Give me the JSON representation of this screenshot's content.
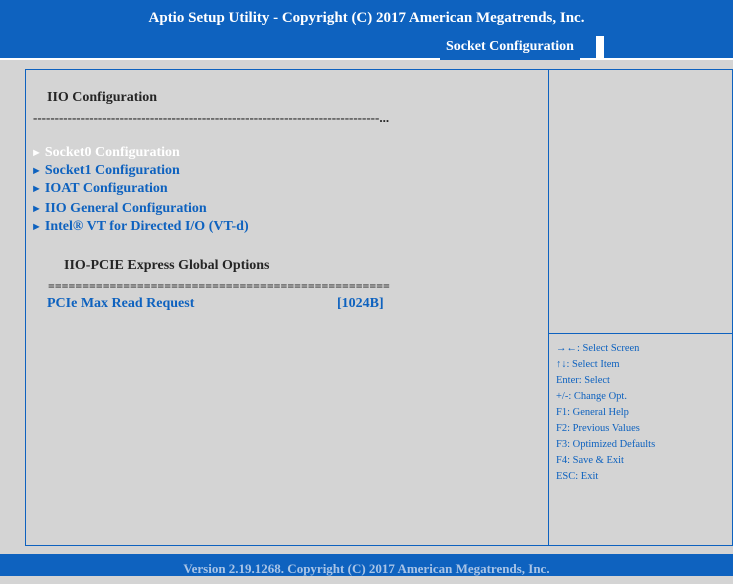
{
  "header": {
    "title": "Aptio Setup Utility - Copyright (C) 2017 American Megatrends, Inc."
  },
  "tabs": [
    {
      "label": "Socket Configuration"
    }
  ],
  "main": {
    "section_title": "IIO Configuration",
    "dashes": "--------------------------------------------------------------------------------...",
    "menu_arrow": "►",
    "menu_items": [
      {
        "label": "Socket0 Configuration"
      },
      {
        "label": "Socket1 Configuration"
      },
      {
        "label": "IOAT Configuration"
      },
      {
        "label": "IIO General Configuration"
      },
      {
        "label": "Intel® VT for Directed I/O (VT-d)"
      }
    ],
    "subheading": "IIO-PCIE Express Global Options",
    "equals_line": "==================================================",
    "option": {
      "label": "PCIe Max Read Request",
      "value": "[1024B]"
    }
  },
  "help": [
    "→←: Select Screen",
    "↑↓: Select Item",
    "Enter: Select",
    "+/-: Change Opt.",
    "F1: General Help",
    "F2: Previous Values",
    "F3: Optimized Defaults",
    "F4: Save & Exit",
    "ESC: Exit"
  ],
  "footer": {
    "version": "Version 2.19.1268. Copyright (C) 2017 American Megatrends, Inc."
  },
  "colors": {
    "accent": "#0e62bf",
    "background": "#d4d4d4",
    "text": "#252525"
  }
}
